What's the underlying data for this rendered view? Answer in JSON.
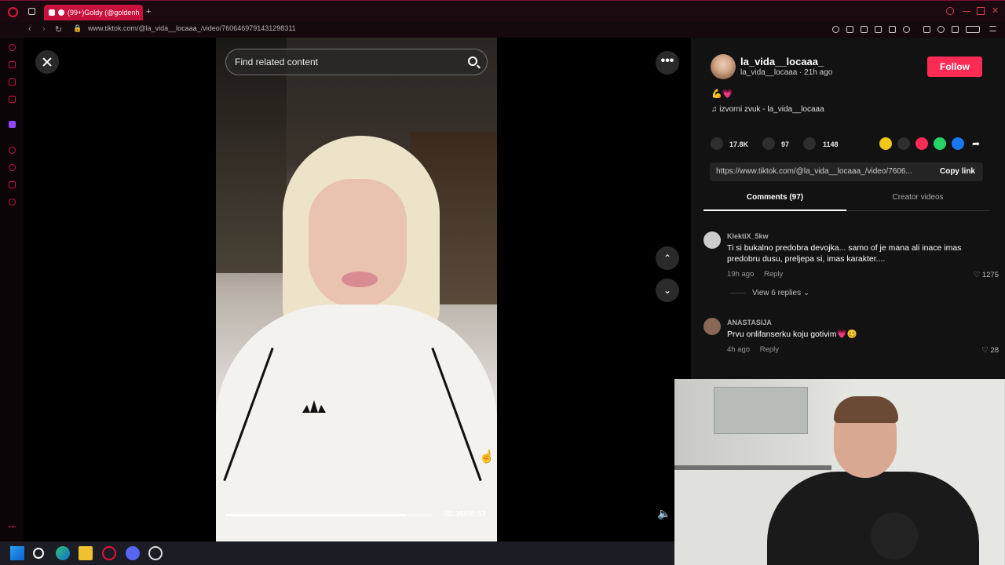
{
  "browser": {
    "tab_title": "(99+)Goldy (@goldenh",
    "url": "www.tiktok.com/@la_vida__locaaa_/video/7606469791431298311",
    "new_tab_label": "+"
  },
  "viewer": {
    "search_placeholder": "Find related content",
    "timecode": "00:35/00:57",
    "progress": 0.87,
    "more_label": "•••",
    "up_label": "⌃",
    "down_label": "⌄",
    "volume_label": "🔈"
  },
  "post": {
    "username": "la_vida__locaaa_",
    "handle_time": "la_vida__locaaa · 21h ago",
    "follow_label": "Follow",
    "caption": "💪💗",
    "music": "♫  izvorni zvuk - la_vida__locaaa",
    "likes": "17.8K",
    "comments": "97",
    "saves": "1148",
    "link": "https://www.tiktok.com/@la_vida__locaaa_/video/7606...",
    "copy_label": "Copy link"
  },
  "tabs": [
    {
      "label": "Comments (97)"
    },
    {
      "label": "Creator videos"
    }
  ],
  "comments": [
    {
      "user": "KlektiX_5kw",
      "text": "Ti si bukalno predobra devojka... samo of je mana ali inace imas predobru dusu, preljepa si, imas karakter....",
      "time": "19h ago",
      "reply": "Reply",
      "likes": "♡ 1275",
      "view_replies": "View 6 replies ⌄"
    },
    {
      "user": "ANASTASIJA",
      "text": "Prvu onlifanserku koju gotivim💗🥴",
      "time": "4h ago",
      "reply": "Reply",
      "likes": "♡ 28"
    }
  ],
  "colors": {
    "accent": "#fe2c55",
    "browser_accent": "#c8103c"
  },
  "icons": {
    "close": "close-icon",
    "search": "search-icon",
    "like": "heart-icon",
    "comment": "comment-icon",
    "save": "bookmark-icon",
    "share": "share-arrow-icon"
  }
}
